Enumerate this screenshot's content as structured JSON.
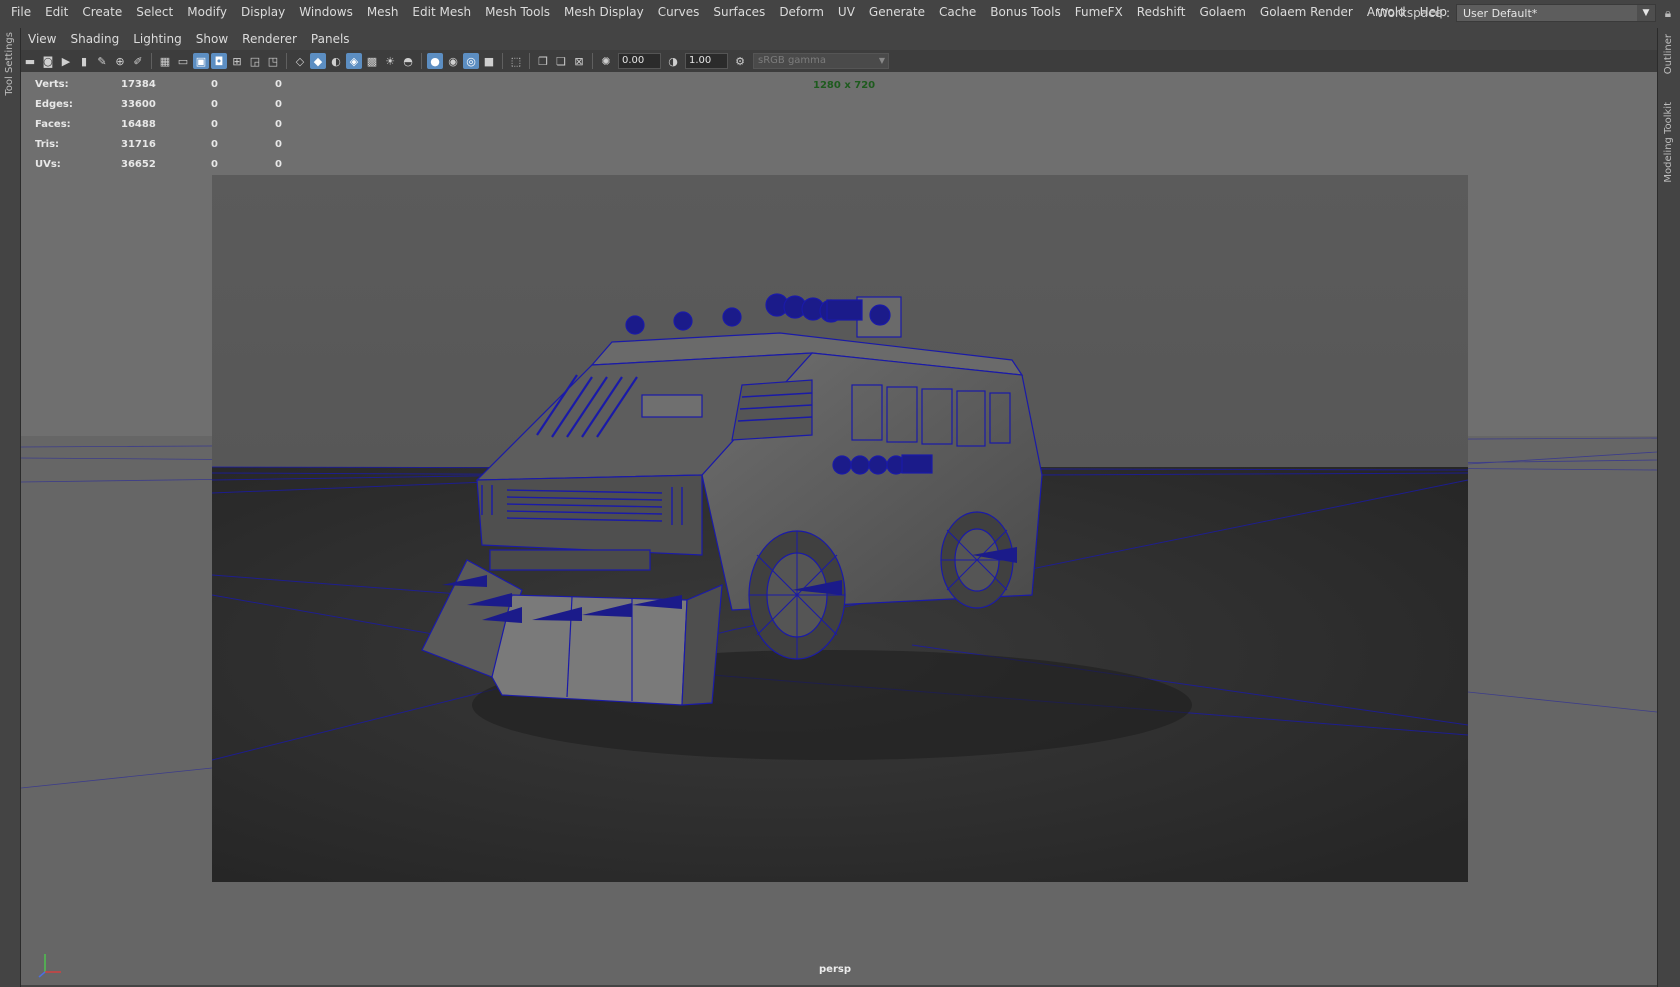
{
  "menubar": {
    "items": [
      "File",
      "Edit",
      "Create",
      "Select",
      "Modify",
      "Display",
      "Windows",
      "Mesh",
      "Edit Mesh",
      "Mesh Tools",
      "Mesh Display",
      "Curves",
      "Surfaces",
      "Deform",
      "UV",
      "Generate",
      "Cache",
      "Bonus Tools",
      "FumeFX",
      "Redshift",
      "Golaem",
      "Golaem Render",
      "Arnold",
      "Help"
    ]
  },
  "workspace": {
    "label": "Workspace :",
    "value": "User Default*"
  },
  "left_tabs": {
    "tool_settings": "Tool Settings"
  },
  "right_tabs": {
    "outliner": "Outliner",
    "modeling_toolkit": "Modeling Toolkit"
  },
  "panel_menu": {
    "items": [
      "View",
      "Shading",
      "Lighting",
      "Show",
      "Renderer",
      "Panels"
    ]
  },
  "toolbar": {
    "exposure_value": "0.00",
    "gamma_value": "1.00",
    "color_space": "sRGB gamma"
  },
  "hud": {
    "rows": [
      {
        "label": "Verts:",
        "total": "17384",
        "selected": "0",
        "component": "0"
      },
      {
        "label": "Edges:",
        "total": "33600",
        "selected": "0",
        "component": "0"
      },
      {
        "label": "Faces:",
        "total": "16488",
        "selected": "0",
        "component": "0"
      },
      {
        "label": "Tris:",
        "total": "31716",
        "selected": "0",
        "component": "0"
      },
      {
        "label": "UVs:",
        "total": "36652",
        "selected": "0",
        "component": "0"
      }
    ]
  },
  "viewport": {
    "resolution": "1280 x 720",
    "camera": "persp",
    "wire_color": "#1a1aa8"
  }
}
